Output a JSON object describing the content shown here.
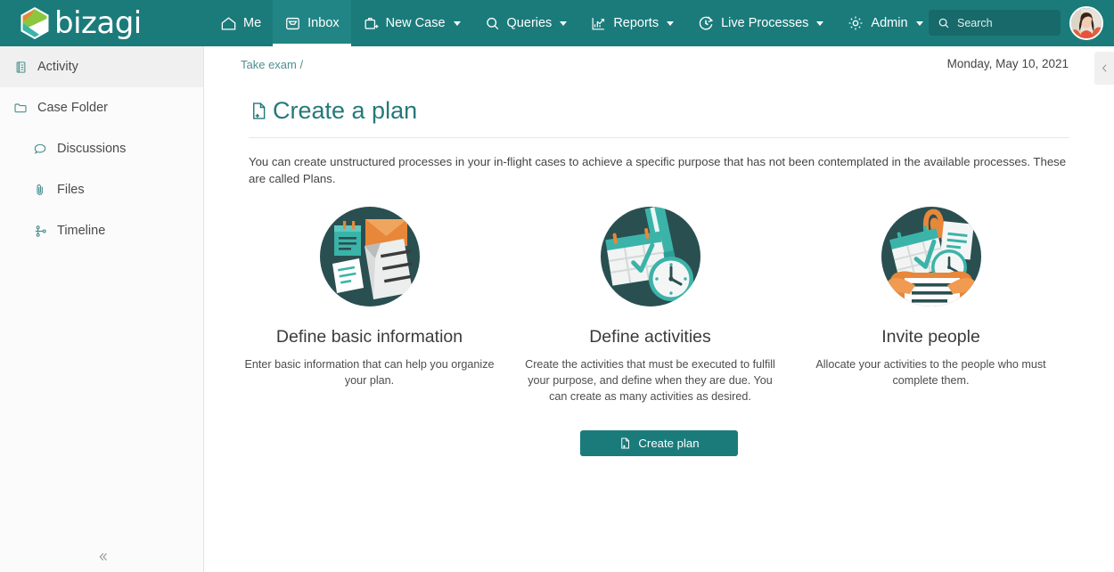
{
  "brand": {
    "name": "bizagi",
    "logo_icon": "bizagi-hexagon-logo",
    "primary_color": "#1b7b7b",
    "accent_orange": "#e8873a",
    "accent_green": "#8cc63f",
    "accent_teal": "#3bb3a9"
  },
  "topnav": {
    "items": [
      {
        "label": "Me",
        "icon": "home-icon",
        "caret": false,
        "active": false
      },
      {
        "label": "Inbox",
        "icon": "inbox-icon",
        "caret": false,
        "active": true
      },
      {
        "label": "New Case",
        "icon": "briefcase-plus-icon",
        "caret": true,
        "active": false
      },
      {
        "label": "Queries",
        "icon": "search-icon",
        "caret": true,
        "active": false
      },
      {
        "label": "Reports",
        "icon": "chart-icon",
        "caret": true,
        "active": false
      },
      {
        "label": "Live Processes",
        "icon": "refresh-clock-icon",
        "caret": true,
        "active": false
      },
      {
        "label": "Admin",
        "icon": "gear-icon",
        "caret": true,
        "active": false
      }
    ],
    "search": {
      "placeholder": "Search",
      "value": "",
      "icon": "search-icon"
    },
    "avatar_alt": "user-avatar"
  },
  "sidebar": {
    "items": [
      {
        "label": "Activity",
        "icon": "activity-list-icon",
        "active": true,
        "sub": false
      },
      {
        "label": "Case Folder",
        "icon": "folder-icon",
        "active": false,
        "sub": false
      },
      {
        "label": "Discussions",
        "icon": "discussion-bubble-icon",
        "active": false,
        "sub": true
      },
      {
        "label": "Files",
        "icon": "paperclip-icon",
        "active": false,
        "sub": true
      },
      {
        "label": "Timeline",
        "icon": "timeline-nodes-icon",
        "active": false,
        "sub": true
      }
    ],
    "collapse_icon": "double-chevron-left-icon"
  },
  "header": {
    "breadcrumb": "Take exam /",
    "date": "Monday, May 10, 2021",
    "collapse_icon": "chevron-left-icon"
  },
  "main": {
    "title": "Create a plan",
    "title_icon": "document-plus-icon",
    "intro": "You can create unstructured processes in your in-flight cases to achieve a specific purpose that has not been contemplated in the available processes. These are called Plans.",
    "cards": [
      {
        "title": "Define basic information",
        "desc": "Enter basic information that can help you organize your plan.",
        "illustration": "documents-envelope-notes-illustration"
      },
      {
        "title": "Define activities",
        "desc": "Create the activities that must be executed to fulfill your purpose, and define when they are due. You can create as many activities as desired.",
        "illustration": "calendar-pencil-clock-illustration"
      },
      {
        "title": "Invite people",
        "desc": "Allocate your activities to the people who must complete them.",
        "illustration": "hands-documents-clock-illustration"
      }
    ],
    "create_button": {
      "label": "Create plan",
      "icon": "document-plus-icon"
    }
  }
}
